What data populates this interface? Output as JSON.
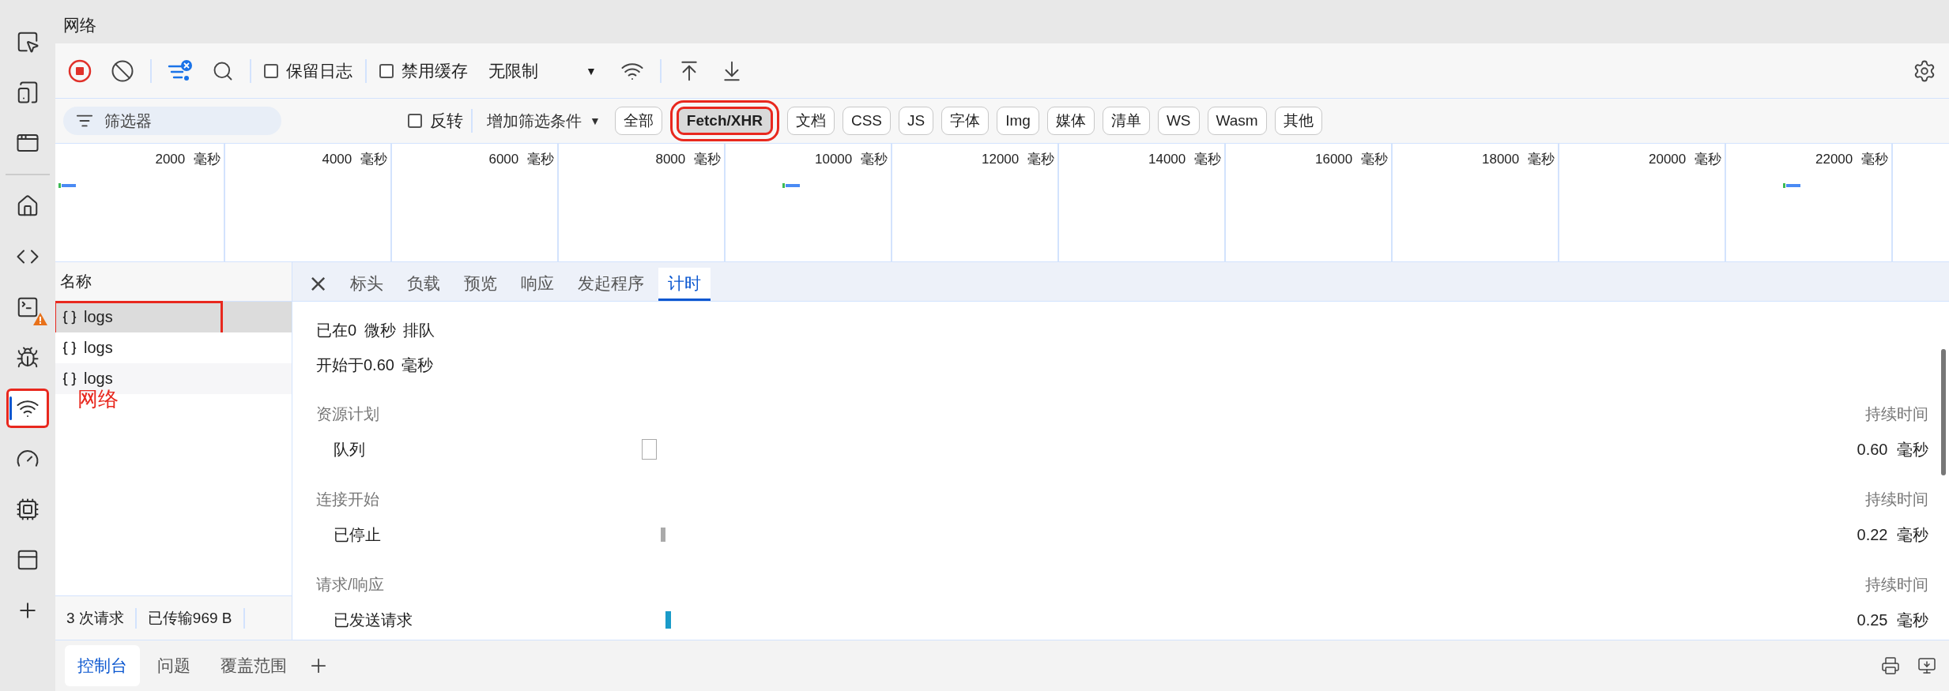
{
  "activity_bar": {
    "items": [
      {
        "selected": false,
        "warning": false,
        "highlighted": false
      },
      {
        "selected": false,
        "warning": false,
        "highlighted": false
      },
      {
        "selected": false,
        "warning": false,
        "highlighted": false
      },
      {
        "selected": false,
        "warning": false,
        "highlighted": false
      },
      {
        "selected": false,
        "warning": false,
        "highlighted": false
      },
      {
        "selected": false,
        "warning": true,
        "highlighted": false
      },
      {
        "selected": false,
        "warning": false,
        "highlighted": false
      },
      {
        "selected": true,
        "warning": false,
        "highlighted": true
      },
      {
        "selected": false,
        "warning": false,
        "highlighted": false
      },
      {
        "selected": false,
        "warning": false,
        "highlighted": false
      },
      {
        "selected": false,
        "warning": false,
        "highlighted": false
      },
      {
        "selected": false,
        "warning": false,
        "highlighted": false
      }
    ]
  },
  "panel": {
    "title": "网络"
  },
  "toolbar": {
    "recording": true,
    "preserve_log": {
      "label": "保留日志",
      "checked": false
    },
    "disable_cache": {
      "label": "禁用缓存",
      "checked": false
    },
    "throttling": {
      "value": "无限制",
      "caret": "▼"
    }
  },
  "filter_bar": {
    "search": {
      "placeholder": "筛选器"
    },
    "invert": {
      "label": "反转",
      "checked": false
    },
    "more_filters": {
      "label": "增加筛选条件",
      "caret": "▼"
    },
    "chips": [
      {
        "label": "全部",
        "selected": false,
        "highlighted": false
      },
      {
        "label": "Fetch/XHR",
        "selected": true,
        "highlighted": true
      },
      {
        "label": "文档",
        "selected": false,
        "highlighted": false
      },
      {
        "label": "CSS",
        "selected": false,
        "highlighted": false
      },
      {
        "label": "JS",
        "selected": false,
        "highlighted": false
      },
      {
        "label": "字体",
        "selected": false,
        "highlighted": false
      },
      {
        "label": "Img",
        "selected": false,
        "highlighted": false
      },
      {
        "label": "媒体",
        "selected": false,
        "highlighted": false
      },
      {
        "label": "清单",
        "selected": false,
        "highlighted": false
      },
      {
        "label": "WS",
        "selected": false,
        "highlighted": false
      },
      {
        "label": "Wasm",
        "selected": false,
        "highlighted": false
      },
      {
        "label": "其他",
        "selected": false,
        "highlighted": false
      }
    ]
  },
  "overview": {
    "ticks": [
      "2000 毫秒",
      "4000 毫秒",
      "6000 毫秒",
      "8000 毫秒",
      "10000 毫秒",
      "12000 毫秒",
      "14000 毫秒",
      "16000 毫秒",
      "18000 毫秒",
      "20000 毫秒",
      "22000 毫秒"
    ]
  },
  "requests": {
    "header": "名称",
    "annotation": "网络",
    "rows": [
      {
        "name": "logs",
        "selected": true,
        "highlighted": true
      },
      {
        "name": "logs",
        "selected": false,
        "highlighted": false
      },
      {
        "name": "logs",
        "selected": false,
        "highlighted": false
      }
    ],
    "summary": [
      "3 次请求",
      "已传输969 B"
    ]
  },
  "details": {
    "close": "×",
    "tabs": [
      {
        "label": "标头",
        "selected": false
      },
      {
        "label": "负载",
        "selected": false
      },
      {
        "label": "预览",
        "selected": false
      },
      {
        "label": "响应",
        "selected": false
      },
      {
        "label": "发起程序",
        "selected": false
      },
      {
        "label": "计时",
        "selected": true
      }
    ],
    "timing": {
      "queued_at": "已在0 微秒 排队",
      "started_at": "开始于0.60 毫秒",
      "sections": [
        {
          "title": "资源计划",
          "duration_header": "持续时间",
          "rows": [
            {
              "label": "队列",
              "kind": "queueing",
              "duration": "0.60 毫秒"
            }
          ]
        },
        {
          "title": "连接开始",
          "duration_header": "持续时间",
          "rows": [
            {
              "label": "已停止",
              "kind": "stalled",
              "duration": "0.22 毫秒"
            }
          ]
        },
        {
          "title": "请求/响应",
          "duration_header": "持续时间",
          "rows": [
            {
              "label": "已发送请求",
              "kind": "sent",
              "duration": "0.25 毫秒"
            }
          ]
        }
      ]
    }
  },
  "drawer": {
    "tabs": [
      {
        "label": "控制台",
        "selected": true
      },
      {
        "label": "问题",
        "selected": false
      },
      {
        "label": "覆盖范围",
        "selected": false
      }
    ]
  }
}
